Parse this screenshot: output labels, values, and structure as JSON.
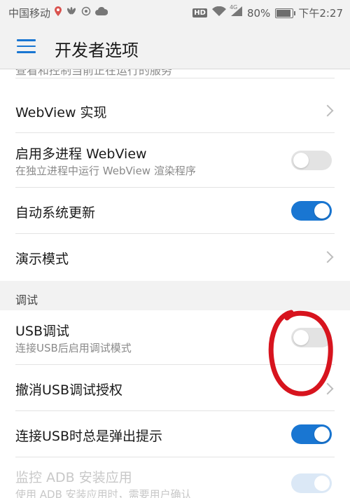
{
  "status_bar": {
    "carrier": "中国移动",
    "network": "4G",
    "battery": "80%",
    "time": "下午2:27",
    "hd": "HD",
    "icons": [
      "location-pin-icon",
      "huawei-icon",
      "data-icon",
      "cloud-icon",
      "hd-icon",
      "wifi-icon",
      "signal-icon",
      "battery-icon"
    ]
  },
  "app_bar": {
    "title": "开发者选项",
    "menu_icon": "menu-icon"
  },
  "rows": {
    "partial_top": {
      "title": "查看和控制当前正在运行的服务"
    },
    "webview_impl": {
      "title": "WebView 实现"
    },
    "multiprocess": {
      "title": "启用多进程 WebView",
      "subtitle": "在独立进程中运行 WebView 渲染程序",
      "state": "off"
    },
    "auto_update": {
      "title": "自动系统更新",
      "state": "on"
    },
    "demo_mode": {
      "title": "演示模式"
    },
    "section_debug": {
      "label": "调试"
    },
    "usb_debug": {
      "title": "USB调试",
      "subtitle": "连接USB后启用调试模式",
      "state": "off"
    },
    "revoke_usb": {
      "title": "撤消USB调试授权"
    },
    "usb_prompt": {
      "title": "连接USB时总是弹出提示",
      "state": "on"
    },
    "adb_install": {
      "title": "监控 ADB 安装应用",
      "subtitle": "使用 ADB 安装应用时，需要用户确认",
      "state": "on-disabled"
    }
  },
  "colors": {
    "accent": "#1976d2",
    "annotation": "#d7141e",
    "background": "#f2f2f2"
  }
}
